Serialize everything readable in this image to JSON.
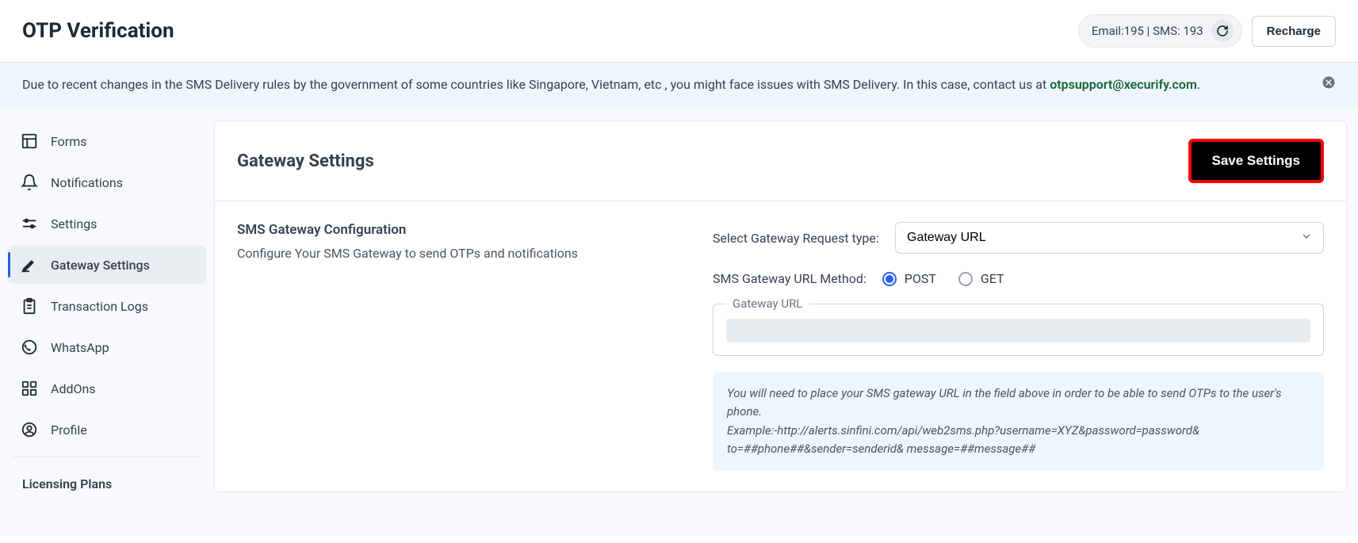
{
  "header": {
    "title": "OTP Verification",
    "credits": "Email:195 | SMS: 193",
    "recharge_label": "Recharge"
  },
  "alert": {
    "text_before": "Due to recent changes in the SMS Delivery rules by the government of some countries like Singapore, Vietnam, etc , you might face issues with SMS Delivery. In this case, contact us at ",
    "email": "otpsupport@xecurify.com",
    "period": "."
  },
  "sidebar": {
    "items": [
      {
        "label": "Forms"
      },
      {
        "label": "Notifications"
      },
      {
        "label": "Settings"
      },
      {
        "label": "Gateway Settings"
      },
      {
        "label": "Transaction Logs"
      },
      {
        "label": "WhatsApp"
      },
      {
        "label": "AddOns"
      },
      {
        "label": "Profile"
      }
    ],
    "licensing": "Licensing Plans"
  },
  "main": {
    "card_title": "Gateway Settings",
    "save_button": "Save Settings",
    "config_subtitle": "SMS Gateway Configuration",
    "config_desc": "Configure Your SMS Gateway to send OTPs and notifications",
    "request_type_label": "Select Gateway Request type:",
    "request_type_value": "Gateway URL",
    "method_label": "SMS Gateway URL Method:",
    "method_post": "POST",
    "method_get": "GET",
    "gateway_url_legend": "Gateway URL",
    "info_line1": "You will need to place your SMS gateway URL in the field above in order to be able to send OTPs to the user's phone.",
    "info_line2": "Example:-http://alerts.sinfini.com/api/web2sms.php?username=XYZ&password=password& to=##phone##&sender=senderid& message=##message##"
  }
}
